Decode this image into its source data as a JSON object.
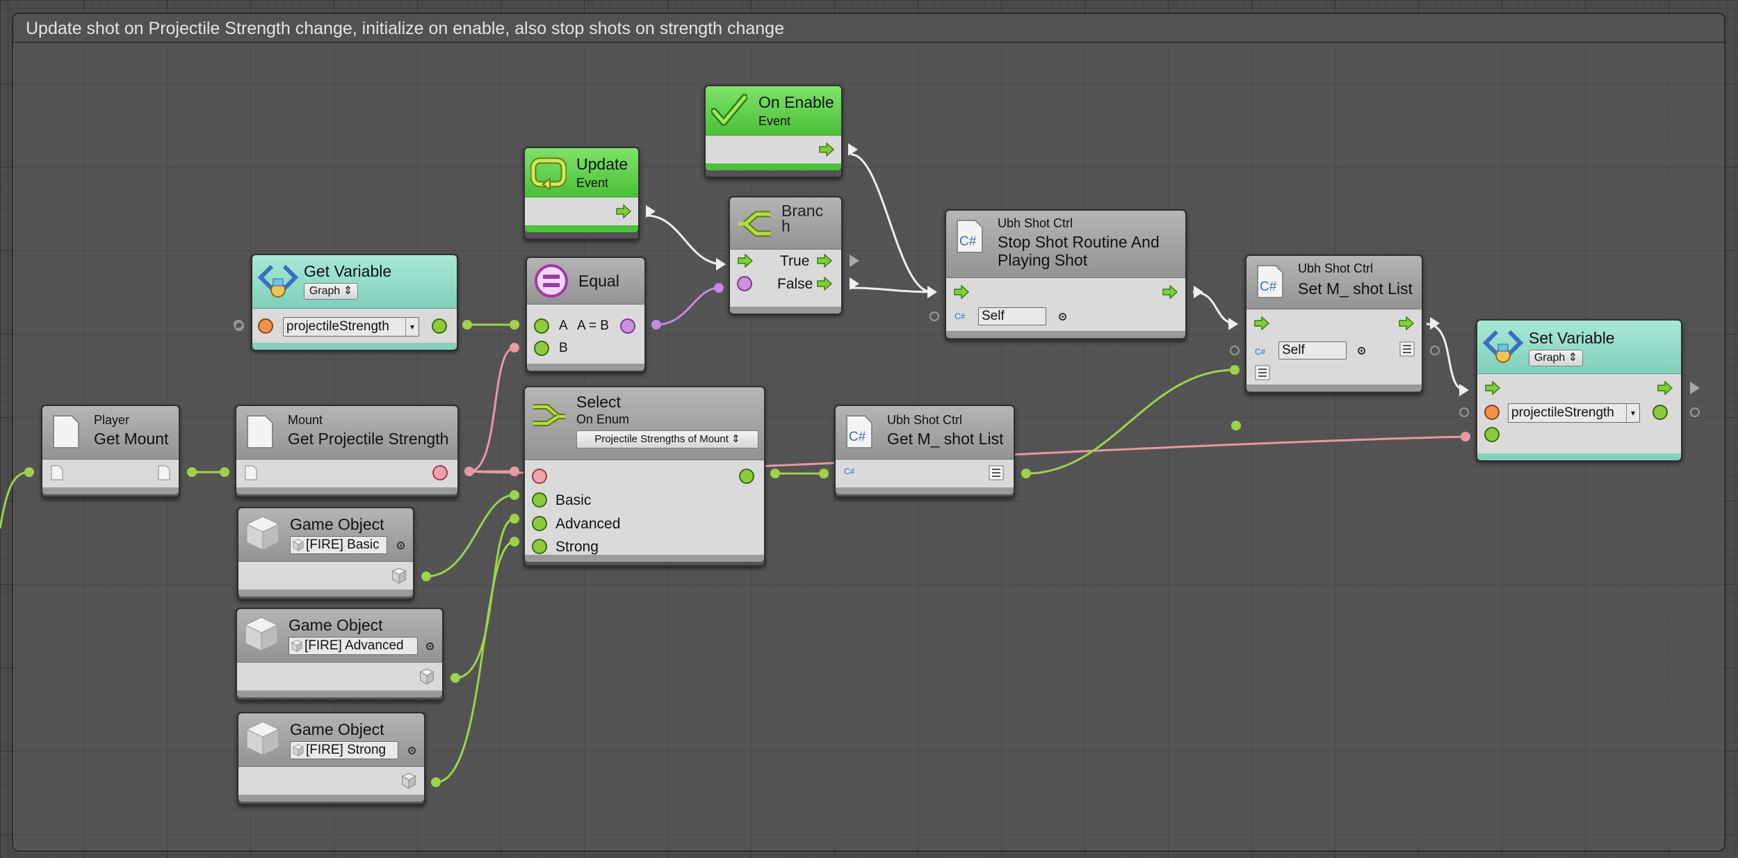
{
  "group": {
    "title": "Update shot on Projectile Strength change, initialize on enable, also stop shots on strength change"
  },
  "nodes": {
    "on_enable": {
      "title": "On Enable",
      "subtitle": "Event"
    },
    "update": {
      "title": "Update",
      "subtitle": "Event"
    },
    "branch": {
      "title": "Branc\nh",
      "ports": [
        "True",
        "False"
      ]
    },
    "stop_shot": {
      "category": "Ubh Shot Ctrl",
      "title": "Stop Shot Routine And",
      "title2": "Playing Shot",
      "self_value": "Self"
    },
    "set_shot_list": {
      "category": "Ubh Shot Ctrl",
      "title": "Set M_ shot List",
      "self_value": "Self"
    },
    "set_variable": {
      "title": "Set Variable",
      "scope": "Graph",
      "variable": "projectileStrength"
    },
    "get_variable": {
      "title": "Get Variable",
      "scope": "Graph",
      "variable": "projectileStrength"
    },
    "equal": {
      "title": "Equal",
      "port_a": "A",
      "port_b": "B",
      "result": "A = B"
    },
    "get_mount": {
      "category": "Player",
      "title": "Get Mount"
    },
    "get_projectile_strength": {
      "category": "Mount",
      "title": "Get Projectile Strength"
    },
    "select": {
      "title": "Select",
      "subtitle": "On Enum",
      "enum": "Projectile Strengths of Mount",
      "options": [
        "Basic",
        "Advanced",
        "Strong"
      ]
    },
    "get_shot_list": {
      "category": "Ubh Shot Ctrl",
      "title": "Get M_ shot List"
    },
    "go_basic": {
      "title": "Game Object",
      "value": "[FIRE] Basic"
    },
    "go_advanced": {
      "title": "Game Object",
      "value": "[FIRE] Advanced"
    },
    "go_strong": {
      "title": "Game Object",
      "value": "[FIRE] Strong"
    }
  },
  "colors": {
    "event_green": "#4bbf39",
    "variable_teal": "#7fd0bb",
    "wire_green": "#9fd24a",
    "wire_pink": "#e69aa6",
    "wire_violet": "#c48be0",
    "wire_white": "#efefef"
  },
  "icons": {
    "on_enable": "checkmark-icon",
    "update": "refresh-icon",
    "branch": "branch-icon",
    "variable": "variable-icon",
    "csharp": "csharp-script-icon",
    "equal": "equal-icon",
    "select": "select-icon",
    "document": "document-icon",
    "game_object": "cube-icon"
  }
}
